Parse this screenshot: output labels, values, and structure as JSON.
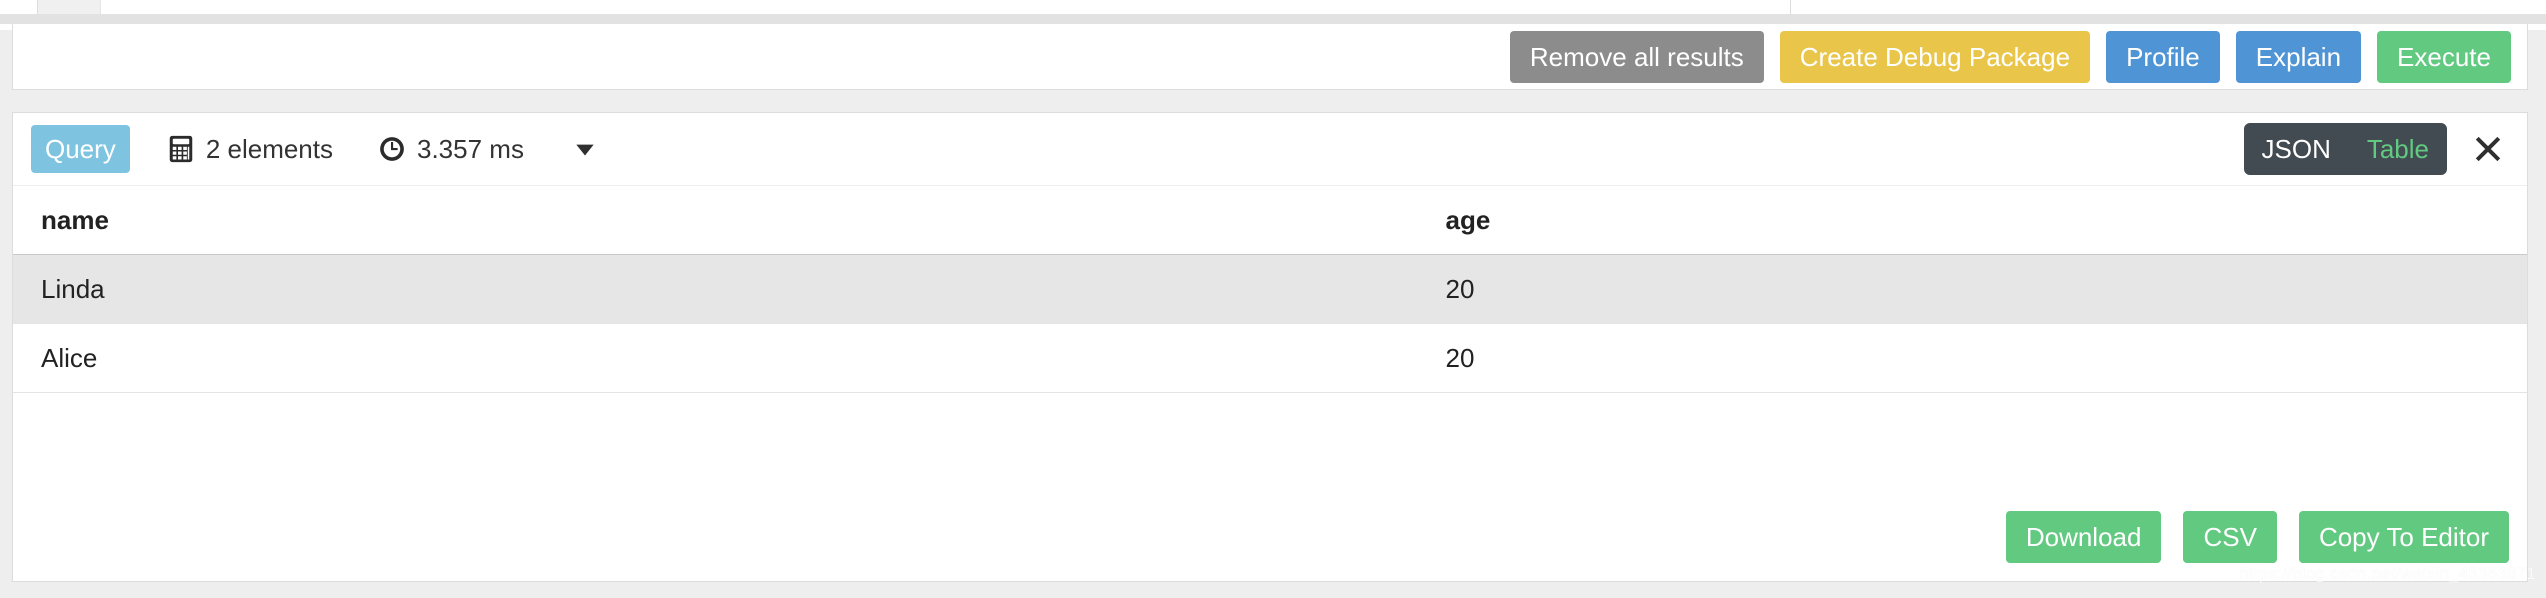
{
  "toolbar": {
    "buttons": [
      {
        "label": "Remove all results",
        "style": "grey",
        "icon": "none"
      },
      {
        "label": "Create Debug Package",
        "style": "yellow",
        "icon": "none"
      },
      {
        "label": "Profile",
        "style": "blue",
        "icon": "none"
      },
      {
        "label": "Explain",
        "style": "blue",
        "icon": "none"
      },
      {
        "label": "Execute",
        "style": "green",
        "icon": "none"
      }
    ]
  },
  "result": {
    "badge_label": "Query",
    "elements_icon": "calculator-icon",
    "elements_text": "2 elements",
    "time_icon": "clock-icon",
    "time_text": "3.357 ms",
    "caret_icon": "chevron-down-icon",
    "close_icon": "close-icon",
    "view_toggle": {
      "options": [
        {
          "label": "JSON",
          "active": false
        },
        {
          "label": "Table",
          "active": true
        }
      ]
    },
    "table": {
      "columns": [
        "name",
        "age"
      ],
      "rows": [
        [
          "Linda",
          "20"
        ],
        [
          "Alice",
          "20"
        ]
      ]
    },
    "footer_buttons": [
      {
        "label": "Download"
      },
      {
        "label": "CSV"
      },
      {
        "label": "Copy To Editor"
      }
    ]
  },
  "watermark": {
    "text": "https://blog.csdn.net/weixin_43363871"
  },
  "colors": {
    "grey": "#8c8c8c",
    "yellow": "#e9c64a",
    "blue": "#4f94d4",
    "green": "#62c981",
    "query_badge": "#7ec4e0",
    "toggle_bg": "#424b51",
    "toggle_active": "#62c981",
    "row_stripe": "#e6e6e6",
    "page_bg": "#eeeeee"
  }
}
